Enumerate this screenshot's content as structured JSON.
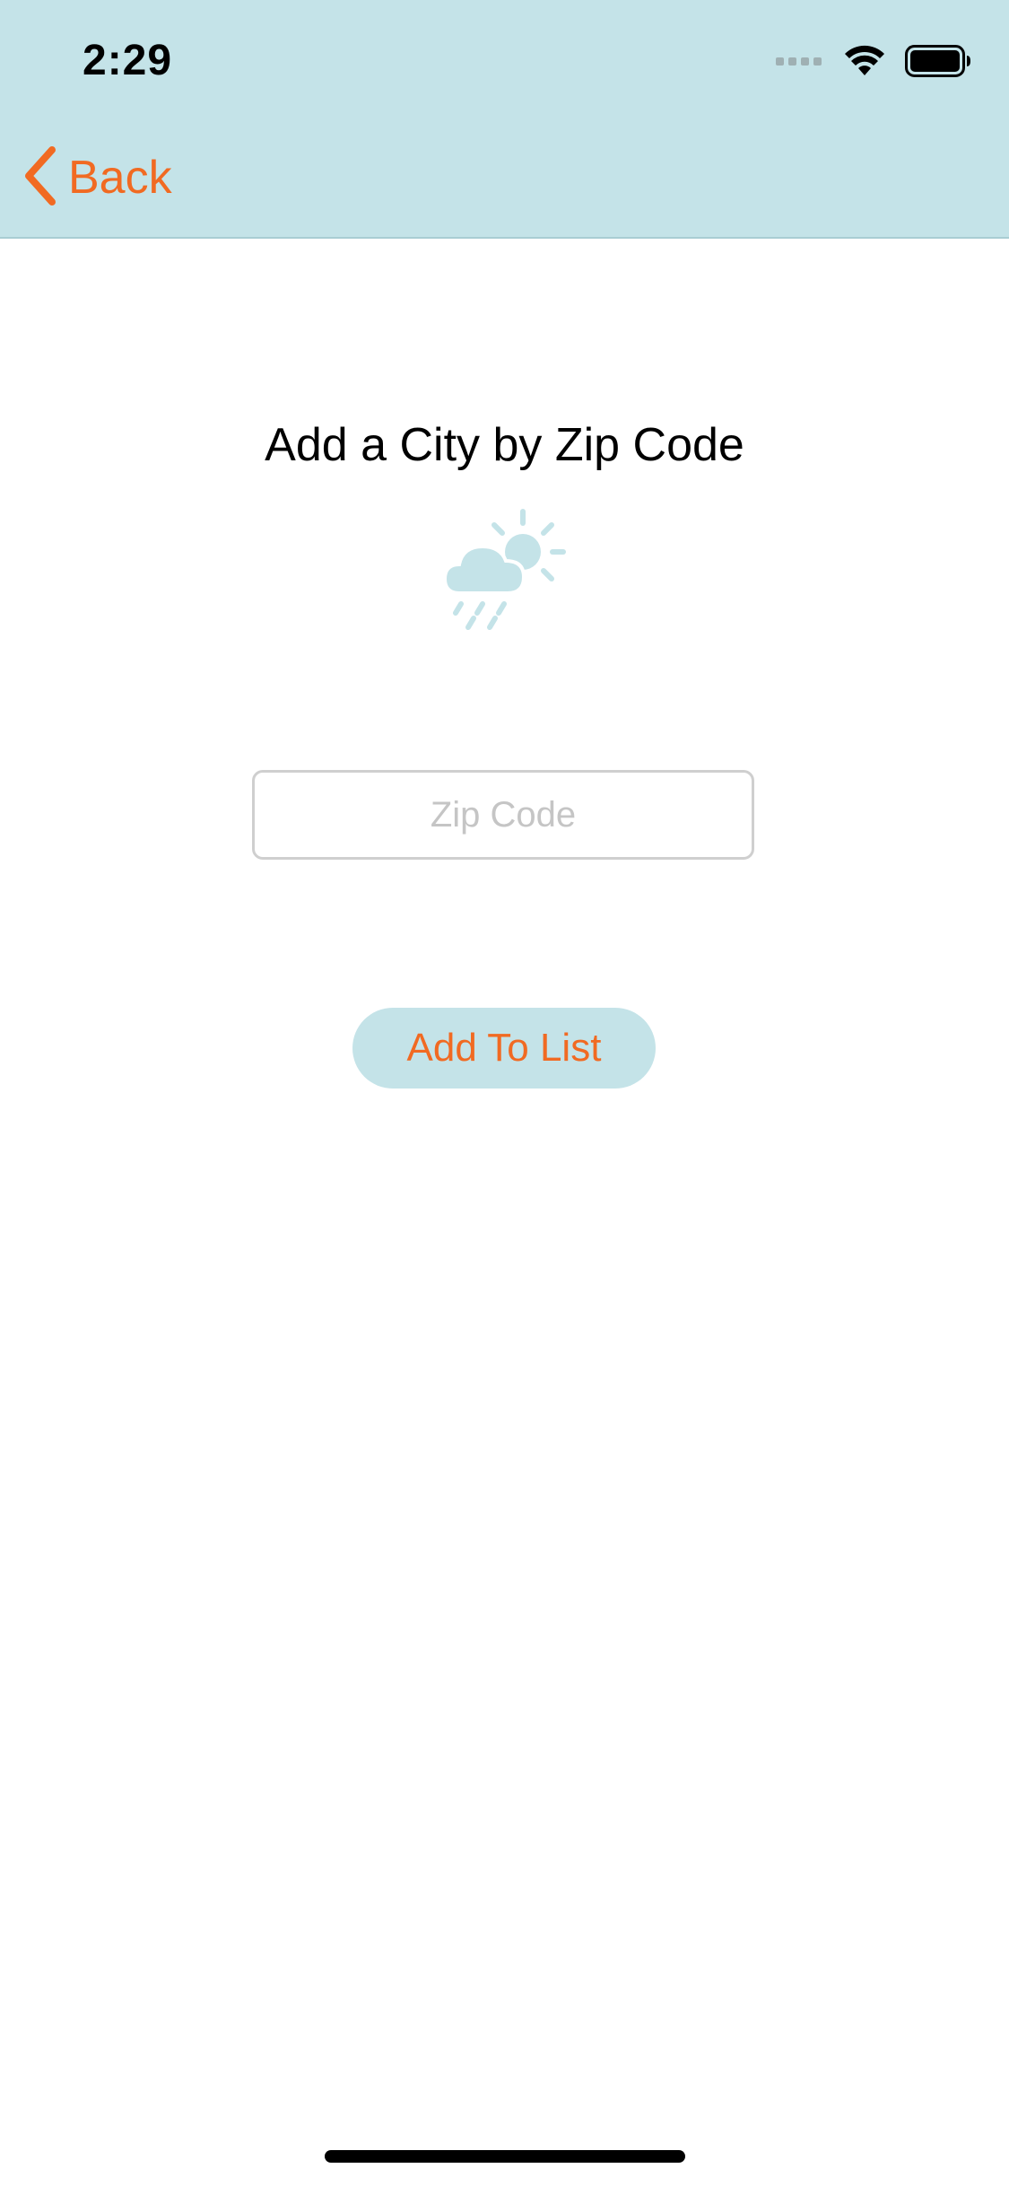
{
  "status_bar": {
    "time": "2:29",
    "icons": [
      "signal-icon",
      "wifi-icon",
      "battery-icon"
    ]
  },
  "nav": {
    "back_label": "Back",
    "back_icon": "chevron-left-icon"
  },
  "main": {
    "title": "Add a City by Zip Code",
    "icon": "weather-rain-sun-icon",
    "zip_input": {
      "placeholder": "Zip Code",
      "value": ""
    },
    "add_button_label": "Add To List"
  },
  "colors": {
    "header_bg": "#c4e3e8",
    "accent": "#f16a22",
    "icon_tint": "#c4e3e8"
  }
}
